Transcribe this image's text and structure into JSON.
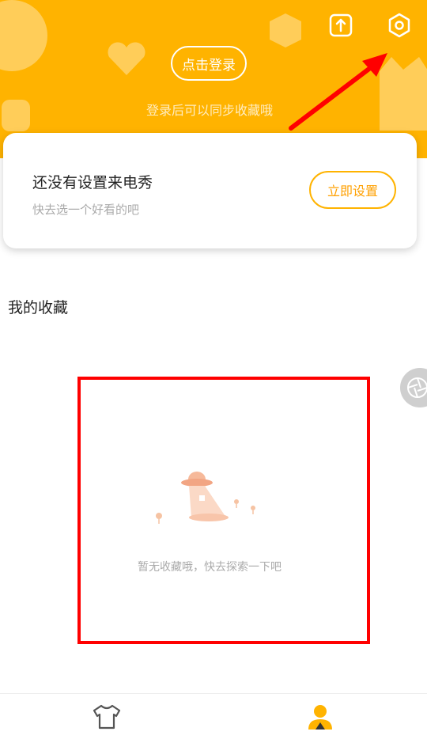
{
  "header": {
    "login_button": "点击登录",
    "login_hint": "登录后可以同步收藏哦"
  },
  "ringtone_card": {
    "title": "还没有设置来电秀",
    "subtitle": "快去选一个好看的吧",
    "action_label": "立即设置"
  },
  "favorites": {
    "title": "我的收藏",
    "empty_text": "暂无收藏哦，快去探索一下吧"
  },
  "bottom_nav": {
    "items": [
      {
        "icon": "tshirt-icon",
        "active": false
      },
      {
        "icon": "user-icon",
        "active": true
      }
    ]
  },
  "colors": {
    "brand": "#FFB300",
    "annotation_red": "#FF0000"
  }
}
